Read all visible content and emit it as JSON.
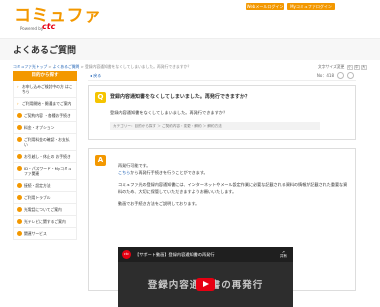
{
  "header": {
    "logo_text": "コミュファ",
    "logo_sub": "Powered by",
    "logo_brand": "ctc",
    "webmail_label": "Webメールログイン",
    "mypage_label": "Myコミュファログイン"
  },
  "page_title": "よくあるご質問",
  "breadcrumb": {
    "home": "コミュファ光トップ",
    "faq": "よくあるご質問",
    "current": "登録内容通知書をなくしてしまいました。再発行できますか？"
  },
  "font_size": {
    "label": "文字サイズ変更",
    "small": "小",
    "medium": "中",
    "large": "大"
  },
  "sidebar": {
    "heading": "目的から探す",
    "items": [
      {
        "label": "お申し込みご検討中の方 はこちら",
        "icon": "arrow"
      },
      {
        "label": "ご利用開始・開通までご案内",
        "icon": "arrow"
      },
      {
        "label": "ご契約内容 ・各種お手続き",
        "icon": "circle"
      },
      {
        "label": "料金・オプション",
        "icon": "circle"
      },
      {
        "label": "ご利用料金の確認・お支払い",
        "icon": "circle"
      },
      {
        "label": "お引越し・休止の お手続き",
        "icon": "circle"
      },
      {
        "label": "ID・パスワード・Myコミュファ関連",
        "icon": "circle"
      },
      {
        "label": "接続・設定方法",
        "icon": "circle"
      },
      {
        "label": "ご利用トラブル",
        "icon": "circle"
      },
      {
        "label": "光電話についてご案内",
        "icon": "circle"
      },
      {
        "label": "光テレビに関するご案内",
        "icon": "circle"
      },
      {
        "label": "関連サービス",
        "icon": "circle"
      }
    ]
  },
  "main": {
    "back_label": "戻る",
    "faq_no": "No：418",
    "question_mark": "Q",
    "question_title": "登録内容通知書をなくしてしまいました。再発行できますか？",
    "question_text": "登録内容通知書をなくしてしまいました。再発行できますか？",
    "category": "カテゴリー：目的から探す ＞ ご契約内容・変更・解約 ＞ 解約方法",
    "answer_mark": "A",
    "answer_p1_line1": "再発行可能です。",
    "answer_p1_link": "こちら",
    "answer_p1_line2": "から再発行手続きを行うことができます。",
    "answer_p2": "コミュファ光の登録内容通知書には、インターネットやメール設定作業に必要な記載される資料の情報が記載された重要な資料のため、大切に保管していただきますようお願いいたします。",
    "answer_p3": "動画でお手続き方法をご説明しております。"
  },
  "video": {
    "channel_logo": "ctc",
    "title": "【サポート動画】登録内容通知書の再発行",
    "share_label": "共有",
    "overlay_text": "登録内容通知書の再発行"
  }
}
